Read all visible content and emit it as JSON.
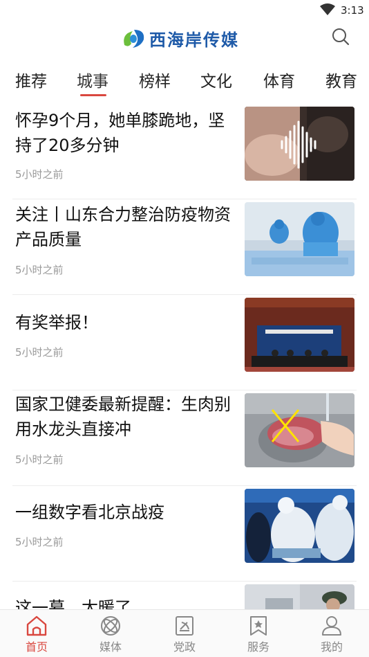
{
  "status_bar": {
    "time": "3:13"
  },
  "header": {
    "logo_text": "西海岸传媒"
  },
  "tabs": [
    {
      "label": "推荐"
    },
    {
      "label": "城事",
      "active": true
    },
    {
      "label": "榜样"
    },
    {
      "label": "文化"
    },
    {
      "label": "体育"
    },
    {
      "label": "教育"
    }
  ],
  "news": [
    {
      "title": "怀孕9个月，她单膝跪地，坚持了20多分钟",
      "time": "5小时之前"
    },
    {
      "title": "关注丨山东合力整治防疫物资产品质量",
      "time": "5小时之前"
    },
    {
      "title": "有奖举报！",
      "time": "5小时之前"
    },
    {
      "title": "国家卫健委最新提醒：生肉别用水龙头直接冲",
      "time": "5小时之前"
    },
    {
      "title": "一组数字看北京战疫",
      "time": "5小时之前"
    },
    {
      "title": "这一幕，太暖了",
      "time": ""
    }
  ],
  "bottom_nav": [
    {
      "label": "首页",
      "icon": "home-icon",
      "active": true
    },
    {
      "label": "媒体",
      "icon": "media-icon"
    },
    {
      "label": "党政",
      "icon": "party-icon"
    },
    {
      "label": "服务",
      "icon": "service-icon"
    },
    {
      "label": "我的",
      "icon": "profile-icon"
    }
  ],
  "colors": {
    "accent": "#d9473f",
    "brand": "#1e5aa8",
    "text": "#111111",
    "muted": "#999999"
  }
}
